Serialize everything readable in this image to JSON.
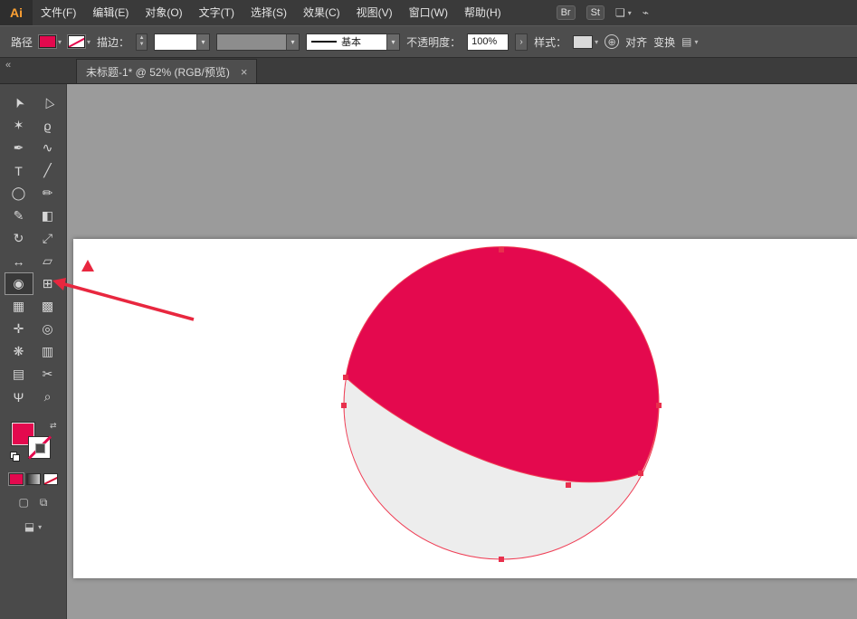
{
  "app": {
    "logo": "Ai",
    "accent": "#e4094e"
  },
  "menubar": {
    "items": [
      "文件(F)",
      "编辑(E)",
      "对象(O)",
      "文字(T)",
      "选择(S)",
      "效果(C)",
      "视图(V)",
      "窗口(W)",
      "帮助(H)"
    ],
    "bridge_badge": "Br",
    "stock_badge": "St",
    "workspace_glyph": "❏",
    "caret": "▾",
    "cs_live_glyph": "⌁"
  },
  "controlbar": {
    "context_label": "路径",
    "stroke_label": "描边：",
    "stepper_up": "▲",
    "stepper_down": "▼",
    "dropdown_caret": "▾",
    "width_profile_value": "基本",
    "opacity_label": "不透明度：",
    "opacity_value": "100%",
    "opacity_more": "›",
    "style_label": "样式：",
    "globe_glyph": "⊕",
    "align_label": "对齐",
    "transform_label": "变换",
    "panel_menu_glyph": "▤"
  },
  "tab": {
    "title": "未标题-1* @ 52% (RGB/预览)",
    "close_glyph": "×"
  },
  "toolbar": {
    "collapse_glyph": "«",
    "tools": [
      {
        "name": "selection-tool",
        "glyph": "➤"
      },
      {
        "name": "direct-selection-tool",
        "glyph": "▷"
      },
      {
        "name": "magic-wand-tool",
        "glyph": "✶"
      },
      {
        "name": "lasso-tool",
        "glyph": "ϱ"
      },
      {
        "name": "pen-tool",
        "glyph": "✒"
      },
      {
        "name": "curvature-tool",
        "glyph": "∿"
      },
      {
        "name": "type-tool",
        "glyph": "T"
      },
      {
        "name": "line-segment-tool",
        "glyph": "╱"
      },
      {
        "name": "ellipse-tool",
        "glyph": "◯"
      },
      {
        "name": "paintbrush-tool",
        "glyph": "✏"
      },
      {
        "name": "pencil-tool",
        "glyph": "✎"
      },
      {
        "name": "eraser-tool",
        "glyph": "◧"
      },
      {
        "name": "rotate-tool",
        "glyph": "↻"
      },
      {
        "name": "scale-tool",
        "glyph": "⤢"
      },
      {
        "name": "width-tool",
        "glyph": "↔"
      },
      {
        "name": "free-transform-tool",
        "glyph": "▱"
      },
      {
        "name": "shape-builder-tool",
        "glyph": "◉"
      },
      {
        "name": "perspective-grid-tool",
        "glyph": "⊞"
      },
      {
        "name": "mesh-tool",
        "glyph": "▦"
      },
      {
        "name": "gradient-tool",
        "glyph": "▩"
      },
      {
        "name": "eyedropper-tool",
        "glyph": "✛"
      },
      {
        "name": "blend-tool",
        "glyph": "◎"
      },
      {
        "name": "symbol-sprayer-tool",
        "glyph": "❋"
      },
      {
        "name": "column-graph-tool",
        "glyph": "▥"
      },
      {
        "name": "artboard-tool",
        "glyph": "▤"
      },
      {
        "name": "slice-tool",
        "glyph": "✂"
      },
      {
        "name": "hand-tool",
        "glyph": "Ψ"
      },
      {
        "name": "zoom-tool",
        "glyph": "⌕"
      }
    ],
    "draw_normal_glyph": "▢",
    "draw_inside_glyph": "⧉",
    "screen_mode_glyph": "⬓"
  },
  "canvas": {
    "shape": {
      "top_fill": "#e4094e",
      "bottom_fill": "#ededed",
      "outline": "#ef3f56",
      "anchor_color": "#e8304d"
    }
  },
  "annotation": {
    "arrow_color": "#e8273f"
  }
}
